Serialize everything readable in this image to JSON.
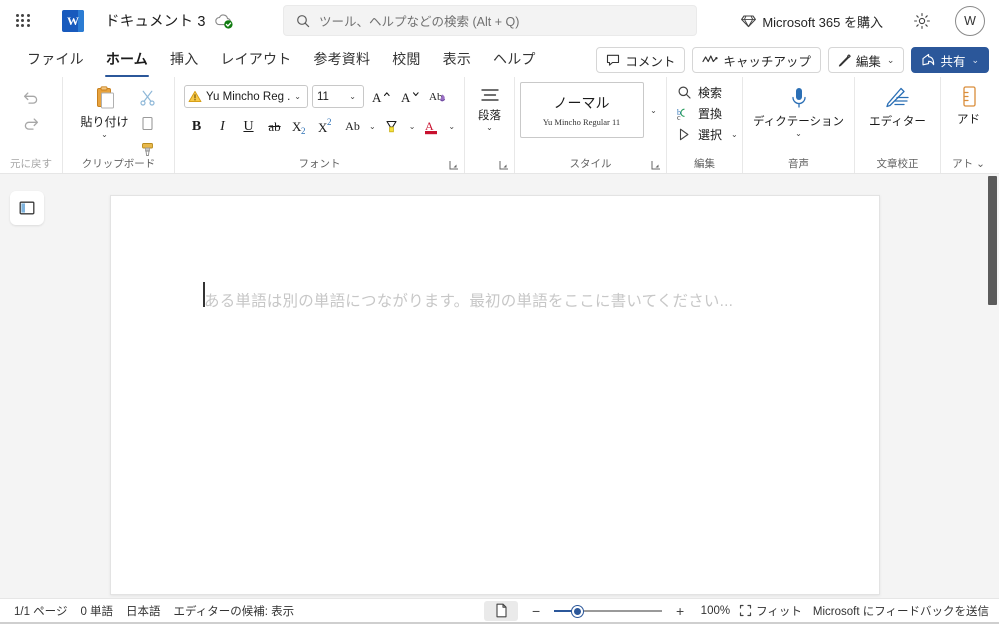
{
  "titlebar": {
    "app_launcher": "app-launcher",
    "app_icon_letter": "W",
    "document_title": "ドキュメント 3",
    "search_placeholder": "ツール、ヘルプなどの検索 (Alt + Q)",
    "buy_label": "Microsoft 365 を購入",
    "avatar_initial": "W"
  },
  "tabs": [
    {
      "label": "ファイル",
      "active": false
    },
    {
      "label": "ホーム",
      "active": true
    },
    {
      "label": "挿入",
      "active": false
    },
    {
      "label": "レイアウト",
      "active": false
    },
    {
      "label": "参考資料",
      "active": false
    },
    {
      "label": "校閲",
      "active": false
    },
    {
      "label": "表示",
      "active": false
    },
    {
      "label": "ヘルプ",
      "active": false
    }
  ],
  "tab_actions": {
    "comment": "コメント",
    "catchup": "キャッチアップ",
    "edit": "編集",
    "share": "共有",
    "chevron": "⌄"
  },
  "ribbon": {
    "undo": {
      "group_label": "元に戻す"
    },
    "clipboard": {
      "group_label": "クリップボード",
      "paste_label": "貼り付け",
      "paste_chevron": "⌄"
    },
    "font": {
      "group_label": "フォント",
      "font_name": "Yu Mincho Reg ...",
      "font_size": "11",
      "grow_label": "A",
      "shrink_label": "A",
      "clear_label": "Ab",
      "bold": "B",
      "italic": "I",
      "underline": "U",
      "strikethrough": "ab",
      "subscript": "X",
      "subscript_sub": "2",
      "superscript": "X",
      "superscript_sup": "2",
      "case_label": "Ab",
      "chevron": "⌄"
    },
    "paragraph": {
      "group_label": "段落",
      "chevron": "⌄"
    },
    "styles": {
      "group_label": "スタイル",
      "card_title": "ノーマル",
      "card_sub": "Yu Mincho Regular 11",
      "chevron": "⌄"
    },
    "editing": {
      "group_label": "編集",
      "find": "検索",
      "replace": "置換",
      "select": "選択",
      "chevron": "⌄"
    },
    "voice": {
      "group_label": "音声",
      "dictate": "ディクテーション",
      "chevron": "⌄"
    },
    "editor": {
      "group_label": "文章校正",
      "editor_label": "エディター"
    },
    "addins": {
      "group_label": "アト",
      "addin_label": "アド",
      "chevron": "⌄"
    }
  },
  "document": {
    "placeholder": "ある単語は別の単語につながります。最初の単語をここに書いてください...",
    "nav_toggle": "navigation-pane"
  },
  "statusbar": {
    "pages": "1/1 ページ",
    "words": "0 単語",
    "language": "日本語",
    "editor_suggestions": "エディターの候補: 表示",
    "zoom_minus": "−",
    "zoom_plus": "+",
    "zoom_value": "100%",
    "fit_label": "フィット",
    "feedback": "Microsoft にフィードバックを送信"
  },
  "colors": {
    "accent": "#2b579a",
    "word_blue": "#185abd",
    "page_bg": "#f4f4f4",
    "scroll_thumb": "#5b5b5b",
    "placeholder_gray": "#c7c7c7"
  }
}
